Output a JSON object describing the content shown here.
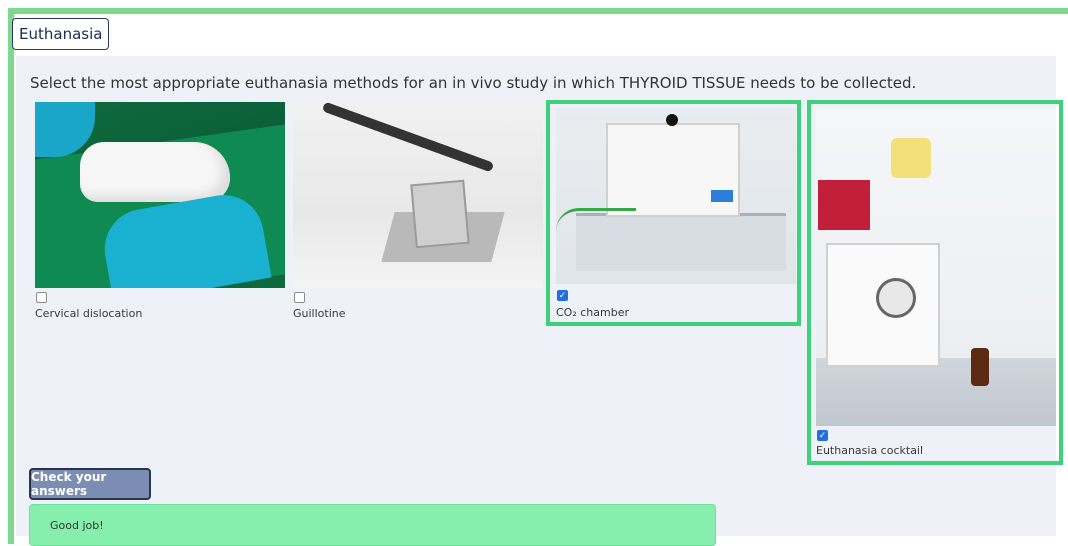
{
  "tab": {
    "label": "Euthanasia"
  },
  "question": "Select the most appropriate euthanasia methods for an in vivo study in which THYROID TISSUE needs to be collected.",
  "options": [
    {
      "label": "Cervical dislocation",
      "checked": false
    },
    {
      "label": "Guillotine",
      "checked": false
    },
    {
      "label": "CO₂ chamber",
      "checked": true
    },
    {
      "label": "Euthanasia cocktail",
      "checked": true
    }
  ],
  "check_button": "Check your answers",
  "feedback": "Good job!",
  "colors": {
    "accent": "#7fd88f",
    "selected": "#3fd07a",
    "button": "#7c8db4",
    "feedback": "#86efad"
  }
}
